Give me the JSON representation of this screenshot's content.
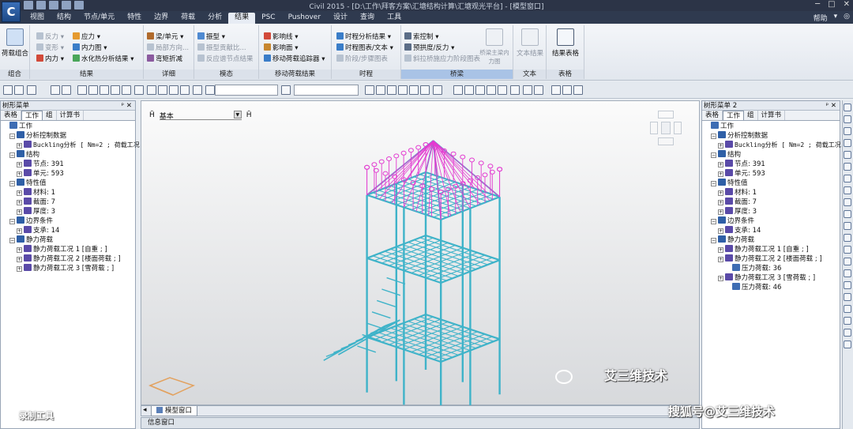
{
  "window": {
    "title": "Civil 2015 - [D:\\工作\\拜客方案\\汇塘结构计算\\汇塘观光平台] - [模型窗口]"
  },
  "menu": {
    "tabs": [
      "视图",
      "结构",
      "节点/单元",
      "特性",
      "边界",
      "荷载",
      "分析",
      "结果",
      "PSC",
      "Pushover",
      "设计",
      "查询",
      "工具"
    ],
    "active": "结果",
    "help": "帮助"
  },
  "ribbon": {
    "group_combo": {
      "label": "组合",
      "big": "荷载组合"
    },
    "group_results": {
      "label": "结果",
      "items": [
        "反力",
        "变形",
        "内力",
        "应力",
        "内力图",
        "水化热分析结果"
      ]
    },
    "group_detail": {
      "label": "详细",
      "items": [
        "梁/单元",
        "局部方向...",
        "弯矩折减"
      ]
    },
    "group_mode": {
      "label": "模态",
      "items": [
        "振型",
        "振型贡献比...",
        "反应谱节点结果"
      ]
    },
    "group_moving": {
      "label": "移动荷载结果",
      "items": [
        "影响线",
        "影响面",
        "移动荷载追踪器"
      ]
    },
    "group_time": {
      "label": "时程",
      "items": [
        "时程分析结果",
        "时程图表/文本",
        "阶段/步骤图表"
      ]
    },
    "group_bridge": {
      "label": "桥梁",
      "items": [
        "索控制",
        "预拱度/反力",
        "斜拉桥施应力阶段图表",
        "桥梁主梁内力图"
      ]
    },
    "group_text": {
      "label": "文本",
      "big": "文本结果"
    },
    "group_table": {
      "label": "表格",
      "big": "结果表格"
    }
  },
  "left_panel": {
    "title": "树形菜单",
    "tabs": [
      "表格",
      "工作",
      "组",
      "计算书"
    ],
    "active_tab": "工作",
    "tree": [
      {
        "text": "工作",
        "level": 0
      },
      {
        "text": "分析控制数据",
        "level": 1
      },
      {
        "text": "Buckling分析 [ Nm=2 ; 荷载工况",
        "level": 2
      },
      {
        "text": "结构",
        "level": 1
      },
      {
        "text": "节点: 391",
        "level": 2
      },
      {
        "text": "单元: 593",
        "level": 2
      },
      {
        "text": "特性值",
        "level": 1
      },
      {
        "text": "材料: 1",
        "level": 2
      },
      {
        "text": "截面: 7",
        "level": 2
      },
      {
        "text": "厚度: 3",
        "level": 2
      },
      {
        "text": "边界条件",
        "level": 1
      },
      {
        "text": "支承: 14",
        "level": 2
      },
      {
        "text": "静力荷载",
        "level": 1
      },
      {
        "text": "静力荷载工况 1 [自重 ; ]",
        "level": 2
      },
      {
        "text": "静力荷载工况 2 [楼面荷载 ; ]",
        "level": 2
      },
      {
        "text": "静力荷载工况 3 [雪荷载 ; ]",
        "level": 2
      }
    ]
  },
  "right_panel": {
    "title": "树形菜单 2",
    "tabs": [
      "表格",
      "工作",
      "组",
      "计算书"
    ],
    "active_tab": "工作",
    "tree": [
      {
        "text": "工作",
        "level": 0
      },
      {
        "text": "分析控制数据",
        "level": 1
      },
      {
        "text": "Buckling分析 [ Nm=2 ; 荷载工况",
        "level": 2
      },
      {
        "text": "结构",
        "level": 1
      },
      {
        "text": "节点: 391",
        "level": 2
      },
      {
        "text": "单元: 593",
        "level": 2
      },
      {
        "text": "特性值",
        "level": 1
      },
      {
        "text": "材料: 1",
        "level": 2
      },
      {
        "text": "截面: 7",
        "level": 2
      },
      {
        "text": "厚度: 3",
        "level": 2
      },
      {
        "text": "边界条件",
        "level": 1
      },
      {
        "text": "支承: 14",
        "level": 2
      },
      {
        "text": "静力荷载",
        "level": 1
      },
      {
        "text": "静力荷载工况 1 [自重 ; ]",
        "level": 2
      },
      {
        "text": "静力荷载工况 2 [楼面荷载 ; ]",
        "level": 2
      },
      {
        "text": "压力荷载: 36",
        "level": 3
      },
      {
        "text": "静力荷载工况 3 [雪荷载 ; ]",
        "level": 2
      },
      {
        "text": "压力荷载: 46",
        "level": 3
      }
    ]
  },
  "viewport": {
    "view_label": "基本",
    "tab": "模型窗口",
    "info": "信息窗口"
  },
  "watermarks": {
    "brand": "艾三维技术",
    "sohu": "搜狐号@艾三维技术",
    "left": "录制工具"
  },
  "colors": {
    "structure": "#3fb3c9",
    "load": "#e23ad0",
    "accent": "#a9c3e6"
  }
}
